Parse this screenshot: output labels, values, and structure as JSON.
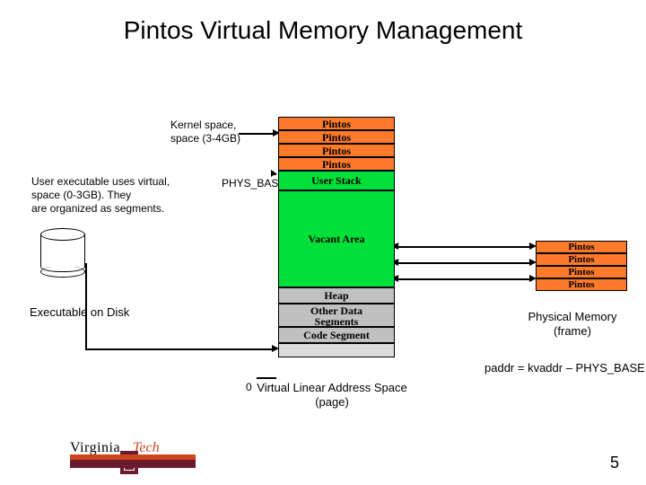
{
  "title": "Pintos Virtual Memory Management",
  "annotations": {
    "kernel": "Kernel space,\nspace (3-4GB)",
    "user_exec": "User executable uses virtual,\nspace (0-3GB). They\nare organized as segments.",
    "phys_base": "PHYS_BASE",
    "exec_disk": "Executable on Disk",
    "zero": "0",
    "vlas": "Virtual Linear Address Space\n(page)",
    "phys_mem": "Physical Memory\n(frame)",
    "equation": "paddr = kvaddr – PHYS_BASE"
  },
  "vas_rows": {
    "pintos": "Pintos",
    "user_stack": "User Stack",
    "vacant": "Vacant Area",
    "heap": "Heap",
    "other_data": "Other Data\nSegments",
    "code_segment": "Code Segment"
  },
  "pm_rows": {
    "pintos": "Pintos"
  },
  "slide_number": "5",
  "logo": {
    "virginia": "Virginia",
    "tech": "Tech"
  }
}
